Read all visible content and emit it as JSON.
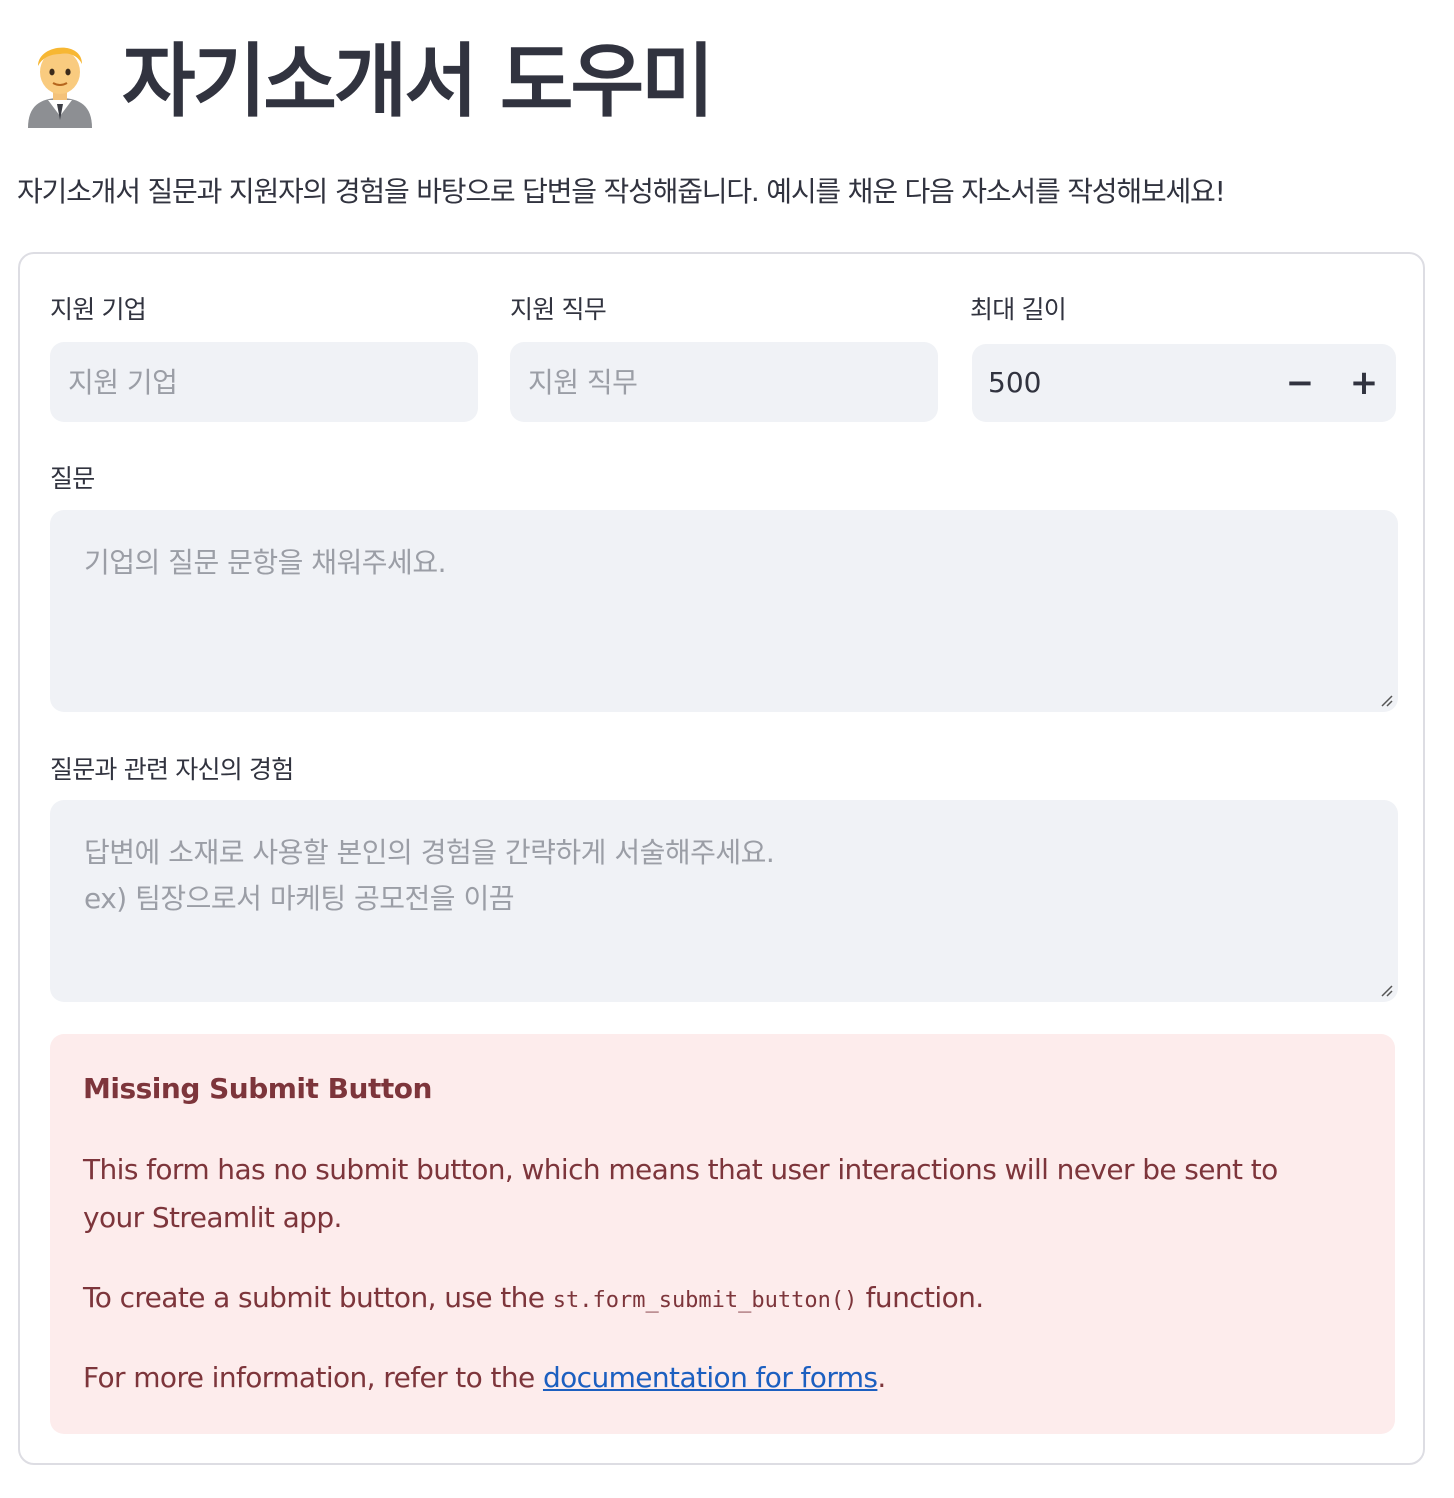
{
  "header": {
    "title": "자기소개서 도우미",
    "emoji_icon": "person-with-blond-hair-office-worker-icon",
    "subtitle": "자기소개서 질문과 지원자의 경험을 바탕으로 답변을 작성해줍니다. 예시를 채운 다음 자소서를 작성해보세요!"
  },
  "form": {
    "company": {
      "label": "지원 기업",
      "placeholder": "지원 기업",
      "value": ""
    },
    "job": {
      "label": "지원 직무",
      "placeholder": "지원 직무",
      "value": ""
    },
    "max_length": {
      "label": "최대 길이",
      "value": "500",
      "decrement": "−",
      "increment": "+"
    },
    "question": {
      "label": "질문",
      "placeholder": "기업의 질문 문항을 채워주세요."
    },
    "experience": {
      "label": "질문과 관련 자신의 경험",
      "placeholder": "답변에 소재로 사용할 본인의 경험을 간략하게 서술해주세요.\nex) 팀장으로서 마케팅 공모전을 이끔"
    }
  },
  "alert": {
    "title": "Missing Submit Button",
    "p1": "This form has no submit button, which means that user interactions will never be sent to your Streamlit app.",
    "p2_before": "To create a submit button, use the ",
    "p2_code": "st.form_submit_button()",
    "p2_after": " function.",
    "p3_before": "For more information, refer to the ",
    "p3_link": "documentation for forms",
    "p3_after": "."
  },
  "colors": {
    "text": "#31333f",
    "input_bg": "#f0f2f6",
    "placeholder": "#9b9ea6",
    "alert_bg": "#fdecec",
    "alert_text": "#7d353b",
    "link": "#1c5fc0"
  }
}
